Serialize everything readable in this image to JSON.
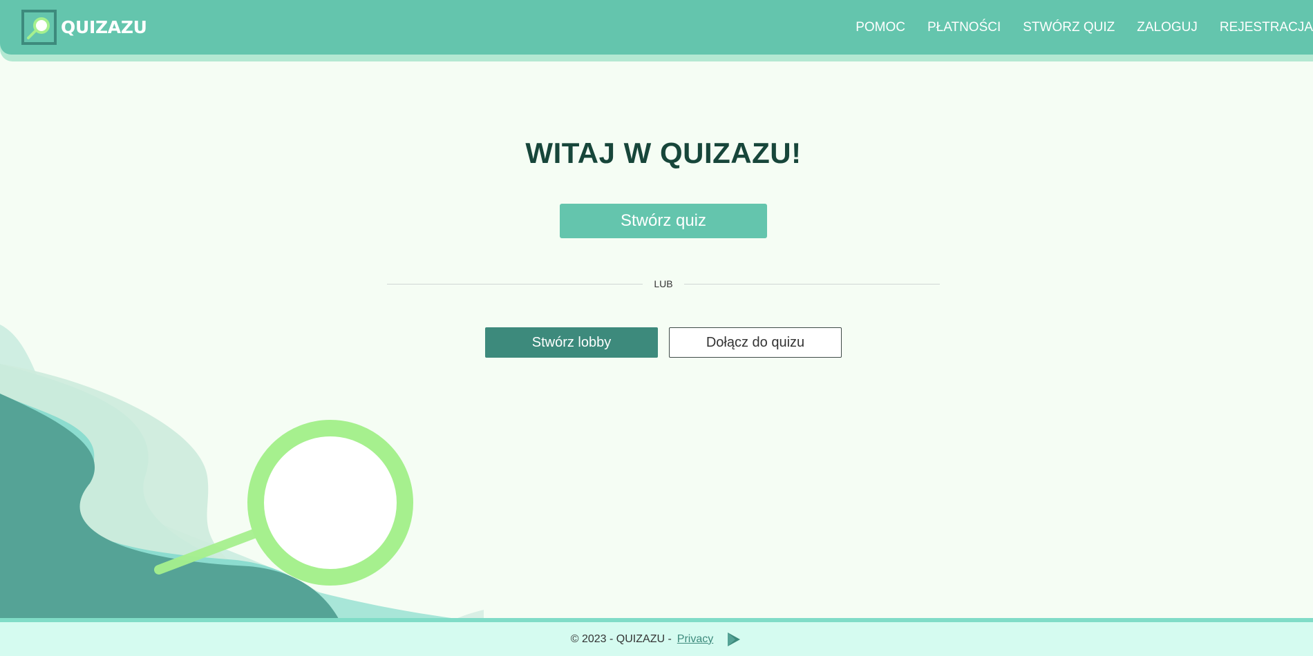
{
  "header": {
    "brand": "QUIZAZU",
    "nav": [
      "POMOC",
      "PŁATNOŚCI",
      "STWÓRZ QUIZ",
      "ZALOGUJ",
      "REJESTRACJA"
    ]
  },
  "main": {
    "title": "WITAJ W QUIZAZU!",
    "create_quiz_label": "Stwórz quiz",
    "divider_label": "LUB",
    "create_lobby_label": "Stwórz lobby",
    "join_quiz_label": "Dołącz do quizu"
  },
  "footer": {
    "copyright": "© 2023 - QUIZAZU -",
    "privacy_label": "Privacy",
    "store_icon": "play-store-icon"
  },
  "colors": {
    "header": "#64c5ad",
    "accent_dark": "#3d8a7c",
    "background": "#f5fdf4",
    "title": "#17463a",
    "footer": "#d5fbf0"
  }
}
